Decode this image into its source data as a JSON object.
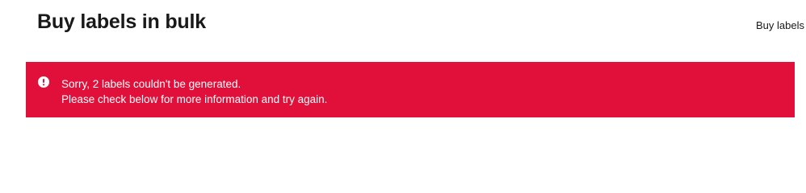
{
  "header": {
    "title": "Buy labels in bulk",
    "link_label": "Buy labels"
  },
  "alert": {
    "type": "error",
    "icon": "alert-circle-icon",
    "line1": "Sorry, 2 labels couldn't be generated.",
    "line2": "Please check below for more information and try again.",
    "background_color": "#e0103a"
  }
}
